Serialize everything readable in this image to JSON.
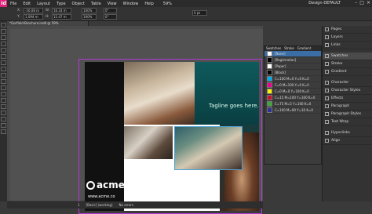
{
  "app": {
    "logo": "Id",
    "workspace": "Design-DEFAULT",
    "zoom": "59%"
  },
  "menu": [
    "File",
    "Edit",
    "Layout",
    "Type",
    "Object",
    "Table",
    "View",
    "Window",
    "Help"
  ],
  "control": {
    "x": "-16.08 m",
    "y": "1.094 m",
    "w": "16.33 m",
    "h": "15.47 m",
    "scale_x": "100%",
    "scale_y": "100%",
    "stroke": "0 pt",
    "angle": "0°",
    "shear": "0°"
  },
  "document_tab": "*Gorfield-Brochure.indd @ 59%",
  "page": {
    "tagline": "Tagline goes here.",
    "brand": "acme",
    "url": "www.acme.co"
  },
  "swatches": {
    "tabs": [
      "Swatches",
      "Stroke",
      "Gradient"
    ],
    "rows": [
      {
        "name": "[None]",
        "color": "#ffffff"
      },
      {
        "name": "[Registration]",
        "color": "#000000"
      },
      {
        "name": "[Paper]",
        "color": "#ffffff"
      },
      {
        "name": "[Black]",
        "color": "#000000"
      },
      {
        "name": "C=100 M=0 Y=0 K=0",
        "color": "#00aeef"
      },
      {
        "name": "C=0 M=100 Y=0 K=0",
        "color": "#ec008c"
      },
      {
        "name": "C=0 M=0 Y=100 K=0",
        "color": "#fff200"
      },
      {
        "name": "C=15 M=100 Y=100 K=0",
        "color": "#c8102e"
      },
      {
        "name": "C=75 M=5 Y=100 K=0",
        "color": "#3aaa35"
      },
      {
        "name": "C=100 M=90 Y=10 K=0",
        "color": "#2e3192"
      }
    ]
  },
  "right_panel": {
    "group1": [
      "Pages",
      "Layers",
      "Links"
    ],
    "group2": [
      "Swatches",
      "Stroke",
      "Gradient"
    ],
    "group3": [
      "Character",
      "Character Styles",
      "Effects",
      "Paragraph",
      "Paragraph Styles",
      "Text Wrap"
    ],
    "group4": [
      "Hyperlinks",
      "Align"
    ]
  },
  "status": {
    "mode": "[Basic] (working)",
    "errors": "No errors",
    "page_num": "1"
  }
}
